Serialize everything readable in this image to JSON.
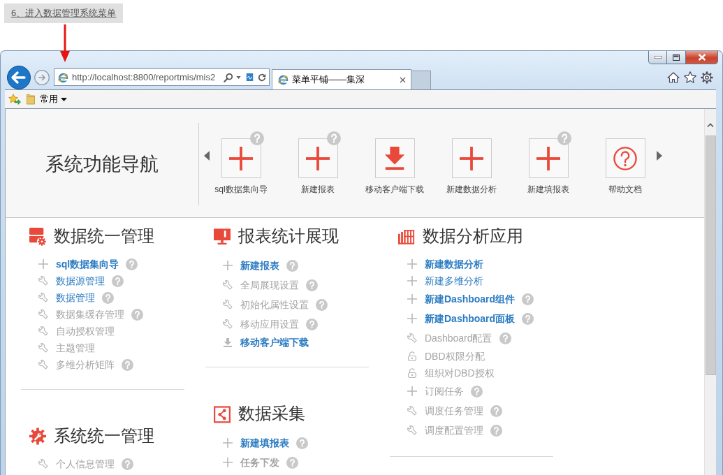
{
  "annotation": {
    "caption": "6、进入数据管理系统菜单"
  },
  "browser": {
    "address": "http://localhost:8800/reportmis/mis2",
    "tabs": [
      {
        "title": "菜单平铺——集深",
        "selected": true
      }
    ],
    "favorites": [
      {
        "label": "常用"
      }
    ]
  },
  "navigator": {
    "title": "系统功能导航",
    "shortcuts": [
      {
        "label": "sql数据集向导",
        "kind": "plus",
        "help": true
      },
      {
        "label": "新建报表",
        "kind": "plus",
        "help": true
      },
      {
        "label": "移动客户端下载",
        "kind": "download",
        "help": false
      },
      {
        "label": "新建数据分析",
        "kind": "plus",
        "help": false
      },
      {
        "label": "新建填报表",
        "kind": "plus",
        "help": true
      },
      {
        "label": "帮助文档",
        "kind": "help",
        "help": false
      }
    ]
  },
  "columns": [
    {
      "sections": [
        {
          "title": "数据统一管理",
          "kind": "server",
          "items": [
            {
              "label": "sql数据集向导",
              "kind": "plus",
              "bold": true,
              "disabled": false,
              "help": true
            },
            {
              "label": "数据源管理",
              "kind": "wrench",
              "bold": false,
              "disabled": false,
              "help": true
            },
            {
              "label": "数据管理",
              "kind": "wrench",
              "bold": false,
              "disabled": false,
              "help": true
            },
            {
              "label": "数据集缓存管理",
              "kind": "wrench",
              "bold": false,
              "disabled": true,
              "help": true
            },
            {
              "label": "自动授权管理",
              "kind": "wrench",
              "bold": false,
              "disabled": true,
              "help": false
            },
            {
              "label": "主题管理",
              "kind": "wrench",
              "bold": false,
              "disabled": true,
              "help": false
            },
            {
              "label": "多维分析矩阵",
              "kind": "wrench",
              "bold": false,
              "disabled": true,
              "help": true
            }
          ]
        },
        {
          "title": "系统统一管理",
          "kind": "gear",
          "items": [
            {
              "label": "个人信息管理",
              "kind": "wrench",
              "bold": false,
              "disabled": true,
              "help": true
            }
          ]
        }
      ]
    },
    {
      "sections": [
        {
          "title": "报表统计展现",
          "kind": "monitor",
          "items": [
            {
              "label": "新建报表",
              "kind": "plus",
              "bold": true,
              "disabled": false,
              "help": true
            },
            {
              "label": "全局展现设置",
              "kind": "wrench",
              "bold": false,
              "disabled": true,
              "help": true
            },
            {
              "label": "初始化属性设置",
              "kind": "wrench",
              "bold": false,
              "disabled": true,
              "help": true
            },
            {
              "label": "移动应用设置",
              "kind": "wrench",
              "bold": false,
              "disabled": true,
              "help": true
            },
            {
              "label": "移动客户端下载",
              "kind": "download",
              "bold": true,
              "disabled": false,
              "help": false
            }
          ]
        },
        {
          "title": "数据采集",
          "kind": "share",
          "items": [
            {
              "label": "新建填报表",
              "kind": "plus",
              "bold": true,
              "disabled": false,
              "help": true
            },
            {
              "label": "任务下发",
              "kind": "plus",
              "bold": true,
              "disabled": true,
              "help": true
            }
          ]
        }
      ]
    },
    {
      "sections": [
        {
          "title": "数据分析应用",
          "kind": "chart",
          "items": [
            {
              "label": "新建数据分析",
              "kind": "plus",
              "bold": true,
              "disabled": false,
              "help": false
            },
            {
              "label": "新建多维分析",
              "kind": "plus",
              "bold": false,
              "disabled": false,
              "help": false
            },
            {
              "label": "新建Dashboard组件",
              "kind": "plus",
              "bold": true,
              "disabled": false,
              "help": true
            },
            {
              "label": "新建Dashboard面板",
              "kind": "plus",
              "bold": true,
              "disabled": false,
              "help": true
            },
            {
              "label": "Dashboard配置",
              "kind": "wrench",
              "bold": false,
              "disabled": true,
              "help": true
            },
            {
              "label": "DBD权限分配",
              "kind": "lock",
              "bold": false,
              "disabled": true,
              "help": false
            },
            {
              "label": "组织对DBD授权",
              "kind": "lock",
              "bold": false,
              "disabled": true,
              "help": false
            },
            {
              "label": "订阅任务",
              "kind": "plus",
              "bold": false,
              "disabled": true,
              "help": true
            },
            {
              "label": "调度任务管理",
              "kind": "wrench",
              "bold": false,
              "disabled": true,
              "help": true
            },
            {
              "label": "调度配置管理",
              "kind": "wrench",
              "bold": false,
              "disabled": true,
              "help": true
            }
          ]
        }
      ]
    }
  ]
}
